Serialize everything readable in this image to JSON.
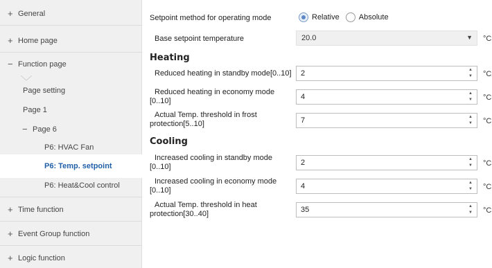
{
  "sidebar": {
    "items": [
      {
        "sign": "+",
        "label": "General"
      },
      {
        "sign": "+",
        "label": "Home page"
      },
      {
        "sign": "−",
        "label": "Function page"
      },
      {
        "sign": "",
        "label": "Page setting"
      },
      {
        "sign": "",
        "label": "Page 1"
      },
      {
        "sign": "−",
        "label": "Page 6"
      },
      {
        "sign": "",
        "label": "P6: HVAC Fan"
      },
      {
        "sign": "",
        "label": "P6: Temp. setpoint",
        "selected": true
      },
      {
        "sign": "",
        "label": "P6: Heat&Cool control"
      },
      {
        "sign": "+",
        "label": "Time function"
      },
      {
        "sign": "+",
        "label": "Event Group function"
      },
      {
        "sign": "+",
        "label": "Logic function"
      }
    ]
  },
  "main": {
    "setpoint_method": {
      "label": "Setpoint method for operating mode",
      "options": [
        "Relative",
        "Absolute"
      ],
      "selected": "Relative"
    },
    "base_setpoint": {
      "label": "Base setpoint temperature",
      "value": "20.0",
      "unit": "°C"
    },
    "heating": {
      "title": "Heating",
      "rows": [
        {
          "label_line1": "Reduced heating in standby mode[0..10]",
          "label_line2": "",
          "value": "2",
          "unit": "°C"
        },
        {
          "label_line1": "Reduced heating in economy mode",
          "label_line2": "[0..10]",
          "value": "4",
          "unit": "°C"
        },
        {
          "label_line1": "Actual Temp. threshold in frost",
          "label_line2": "protection[5..10]",
          "value": "7",
          "unit": "°C"
        }
      ]
    },
    "cooling": {
      "title": "Cooling",
      "rows": [
        {
          "label_line1": "Increased cooling in standby mode",
          "label_line2": "[0..10]",
          "value": "2",
          "unit": "°C"
        },
        {
          "label_line1": "Increased cooling in economy mode",
          "label_line2": "[0..10]",
          "value": "4",
          "unit": "°C"
        },
        {
          "label_line1": "Actual Temp. threshold in heat",
          "label_line2": "protection[30..40]",
          "value": "35",
          "unit": "°C"
        }
      ]
    }
  },
  "icons": {
    "select_arrow": "caret-down-icon",
    "spin_up": "spin-up-icon",
    "spin_down": "spin-down-icon"
  }
}
